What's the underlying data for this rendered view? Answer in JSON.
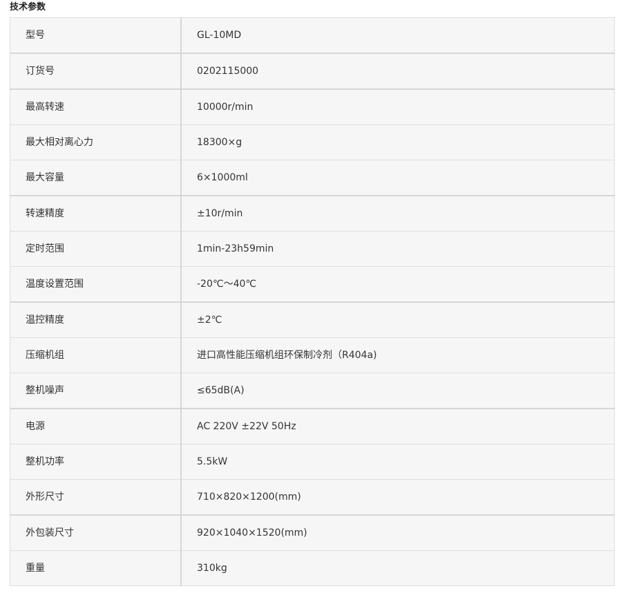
{
  "title": "技术参数",
  "specs": [
    {
      "label": "型号",
      "value": "GL-10MD"
    },
    {
      "label": "订货号",
      "value": "0202115000"
    },
    {
      "label": "最高转速",
      "value": "10000r/min"
    },
    {
      "label": "最大相对离心力",
      "value": "18300×g"
    },
    {
      "label": "最大容量",
      "value": "6×1000ml"
    },
    {
      "label": "转速精度",
      "value": "±10r/min"
    },
    {
      "label": "定时范围",
      "value": "1min-23h59min"
    },
    {
      "label": "温度设置范围",
      "value": "-20℃～40℃"
    },
    {
      "label": "温控精度",
      "value": "±2℃"
    },
    {
      "label": "压缩机组",
      "value": "进口高性能压缩机组环保制冷剂（R404a)"
    },
    {
      "label": "整机噪声",
      "value": "≤65dB(A)"
    },
    {
      "label": "电源",
      "value": "AC 220V ±22V 50Hz"
    },
    {
      "label": "整机功率",
      "value": "5.5kW"
    },
    {
      "label": "外形尺寸",
      "value": "710×820×1200(mm)"
    },
    {
      "label": "外包装尺寸",
      "value": "920×1040×1520(mm)"
    },
    {
      "label": "重量",
      "value": "310kg"
    }
  ]
}
